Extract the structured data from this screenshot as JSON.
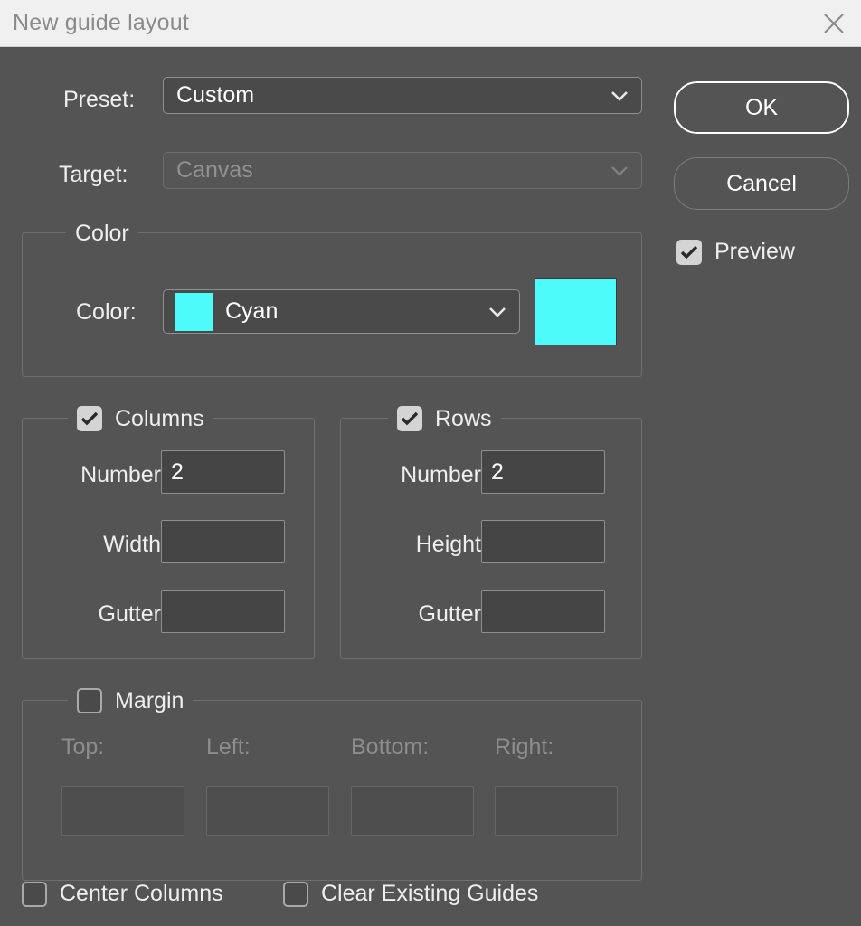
{
  "window": {
    "title": "New guide layout",
    "close_icon": "close-icon"
  },
  "preset": {
    "label": "Preset:",
    "value": "Custom",
    "chevron_icon": "chevron-down-icon"
  },
  "target": {
    "label": "Target:",
    "value": "Canvas",
    "chevron_icon": "chevron-down-icon",
    "disabled": true
  },
  "buttons": {
    "ok": "OK",
    "cancel": "Cancel"
  },
  "preview": {
    "label": "Preview",
    "checked": true
  },
  "color_group": {
    "legend": "Color",
    "field_label": "Color:",
    "value": "Cyan",
    "swatch_hex": "#4dfbfb",
    "chevron_icon": "chevron-down-icon"
  },
  "columns_group": {
    "legend": "Columns",
    "checked": true,
    "fields": [
      {
        "label": "Number",
        "value": "2"
      },
      {
        "label": "Width",
        "value": ""
      },
      {
        "label": "Gutter",
        "value": ""
      }
    ]
  },
  "rows_group": {
    "legend": "Rows",
    "checked": true,
    "fields": [
      {
        "label": "Number",
        "value": "2"
      },
      {
        "label": "Height",
        "value": ""
      },
      {
        "label": "Gutter",
        "value": ""
      }
    ]
  },
  "margin_group": {
    "legend": "Margin",
    "checked": false,
    "fields": [
      {
        "label": "Top:",
        "value": ""
      },
      {
        "label": "Left:",
        "value": ""
      },
      {
        "label": "Bottom:",
        "value": ""
      },
      {
        "label": "Right:",
        "value": ""
      }
    ]
  },
  "footer": {
    "center_columns": {
      "label": "Center Columns",
      "checked": false
    },
    "clear_existing_guides": {
      "label": "Clear Existing Guides",
      "checked": false
    }
  },
  "theme": {
    "dialog_bg": "#545454",
    "titlebar_bg": "#f0f0f0",
    "accent": "#4dfbfb"
  }
}
